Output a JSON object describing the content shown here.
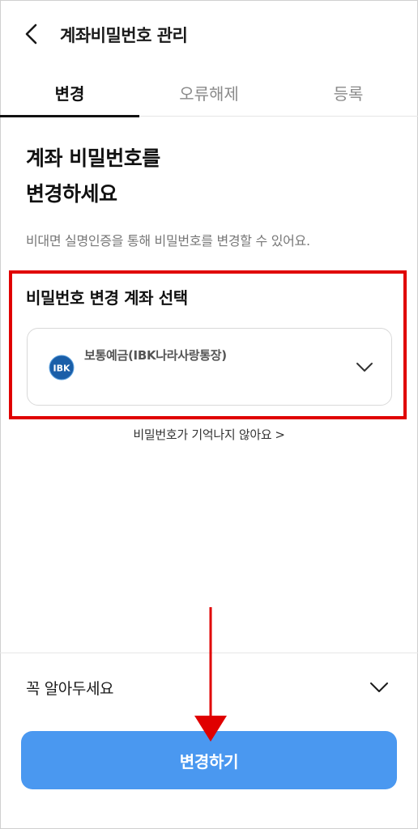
{
  "header": {
    "title": "계좌비밀번호 관리",
    "back_icon": "chevron-left-icon"
  },
  "tabs": [
    {
      "label": "변경",
      "active": true
    },
    {
      "label": "오류해제",
      "active": false
    },
    {
      "label": "등록",
      "active": false
    }
  ],
  "main": {
    "headline_line1": "계좌 비밀번호를",
    "headline_line2": "변경하세요",
    "subtext": "비대면 실명인증을 통해 비밀번호를 변경할 수 있어요.",
    "section_label": "비밀번호 변경 계좌 선택",
    "account": {
      "name": "보통예금(IBK나라사랑통장)",
      "bank_logo_text": "IBK",
      "chevron_icon": "chevron-down-icon"
    },
    "forgot_link": "비밀번호가 기억나지 않아요",
    "forgot_chevron": ">"
  },
  "notice": {
    "label": "꼭 알아두세요",
    "chevron_icon": "chevron-down-icon"
  },
  "footer": {
    "primary_button": "변경하기"
  },
  "colors": {
    "accent": "#4a98f0",
    "highlight": "#e00000",
    "logo_blue": "#1a5ea8"
  }
}
